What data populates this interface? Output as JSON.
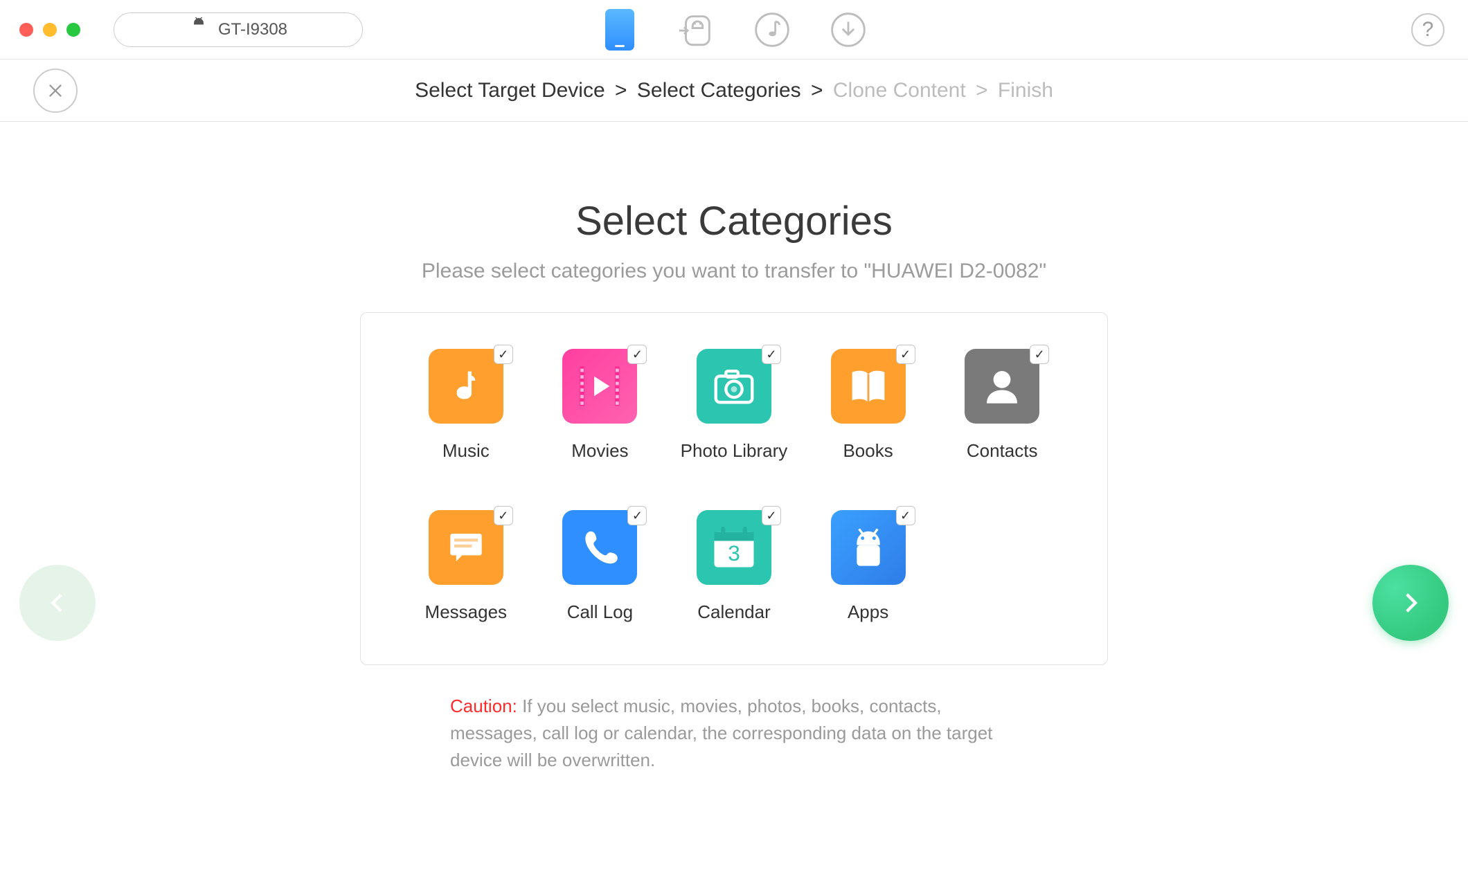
{
  "titlebar": {
    "device_label": "GT-I9308"
  },
  "breadcrumb": {
    "step1": "Select Target Device",
    "step2": "Select Categories",
    "step3": "Clone Content",
    "step4": "Finish",
    "sep": ">"
  },
  "page": {
    "title": "Select Categories",
    "subtitle": "Please select categories you want to transfer to \"HUAWEI D2-0082\""
  },
  "categories": {
    "music": "Music",
    "movies": "Movies",
    "photo_library": "Photo Library",
    "books": "Books",
    "contacts": "Contacts",
    "messages": "Messages",
    "call_log": "Call Log",
    "calendar": "Calendar",
    "apps": "Apps"
  },
  "caution": {
    "label": "Caution:",
    "text": "  If you select music, movies, photos, books, contacts, messages, call log or calendar, the corresponding data on the target device will be overwritten."
  },
  "help": {
    "label": "?"
  },
  "colors": {
    "music": "#ff9f2e",
    "movies_a": "#ff3fa0",
    "movies_b": "#ff6fb8",
    "photo": "#2bc5b0",
    "books": "#ff9f2e",
    "contacts": "#7a7a7a",
    "messages": "#ff9f2e",
    "calllog": "#2f8fff",
    "calendar": "#2bc5b0",
    "apps": "#3aa0ff"
  }
}
